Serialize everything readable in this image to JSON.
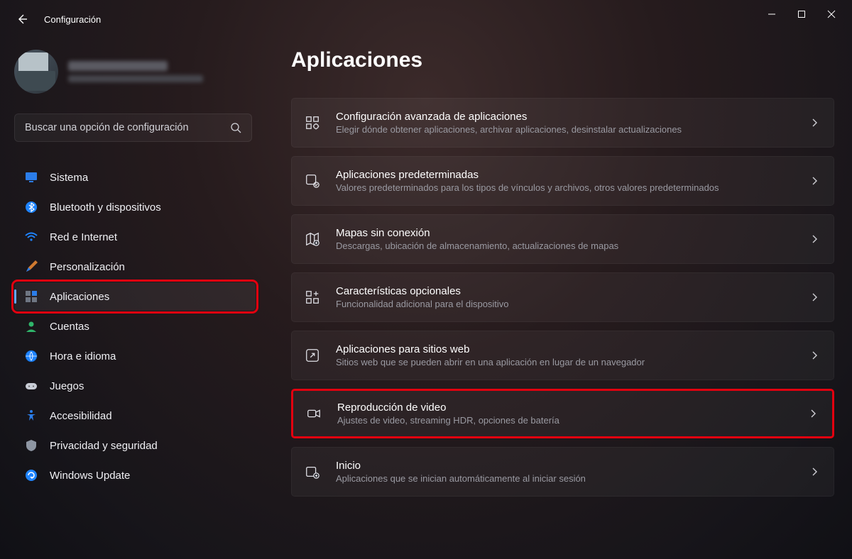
{
  "header": {
    "app_title": "Configuración"
  },
  "search": {
    "placeholder": "Buscar una opción de configuración"
  },
  "sidebar": {
    "items": [
      {
        "label": "Sistema"
      },
      {
        "label": "Bluetooth y dispositivos"
      },
      {
        "label": "Red e Internet"
      },
      {
        "label": "Personalización"
      },
      {
        "label": "Aplicaciones"
      },
      {
        "label": "Cuentas"
      },
      {
        "label": "Hora e idioma"
      },
      {
        "label": "Juegos"
      },
      {
        "label": "Accesibilidad"
      },
      {
        "label": "Privacidad y seguridad"
      },
      {
        "label": "Windows Update"
      }
    ]
  },
  "main": {
    "title": "Aplicaciones",
    "cards": [
      {
        "title": "Configuración avanzada de aplicaciones",
        "sub": "Elegir dónde obtener aplicaciones, archivar aplicaciones, desinstalar actualizaciones"
      },
      {
        "title": "Aplicaciones predeterminadas",
        "sub": "Valores predeterminados para los tipos de vínculos y archivos, otros valores predeterminados"
      },
      {
        "title": "Mapas sin conexión",
        "sub": "Descargas, ubicación de almacenamiento, actualizaciones de mapas"
      },
      {
        "title": "Características opcionales",
        "sub": "Funcionalidad adicional para el dispositivo"
      },
      {
        "title": "Aplicaciones para sitios web",
        "sub": "Sitios web que se pueden abrir en una aplicación en lugar de un navegador"
      },
      {
        "title": "Reproducción de video",
        "sub": "Ajustes de video, streaming HDR, opciones de batería"
      },
      {
        "title": "Inicio",
        "sub": "Aplicaciones que se inician automáticamente al iniciar sesión"
      }
    ]
  }
}
